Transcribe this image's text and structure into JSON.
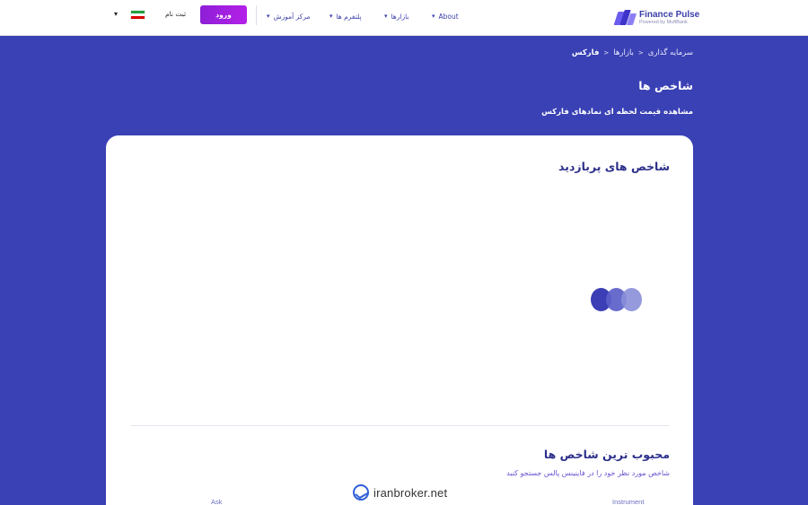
{
  "header": {
    "logo": {
      "title": "Finance Pulse",
      "subtitle": "Powered by MuftBank"
    },
    "nav": [
      {
        "label": "About"
      },
      {
        "label": "بازارها"
      },
      {
        "label": "پلتفرم ها"
      },
      {
        "label": "مرکز آموزش"
      }
    ],
    "login_label": "ورود",
    "signup_label": "ثبت نام",
    "language_flag": "iran-flag-icon"
  },
  "hero": {
    "breadcrumb": [
      {
        "label": "سرمایه گذاری"
      },
      {
        "label": "بازارها"
      },
      {
        "label": "فارکس"
      }
    ],
    "title": "شاخص ها",
    "subtitle": "مشاهده قیمت لحظه ای نمادهای فارکس"
  },
  "card": {
    "popular_title": "شاخص های پربازدید",
    "favorites_title": "محبوب ترین شاخص ها",
    "favorites_subtitle": "شاخص مورد نظر خود را در فاینینس پالس جستجو کنید",
    "columns": {
      "instrument": "Instrument",
      "ask": "Ask"
    }
  },
  "watermark": {
    "text": "iranbroker.net"
  },
  "colors": {
    "brand": "#3a41b4",
    "accent": "#b420e8",
    "title": "#2c2f8a"
  }
}
